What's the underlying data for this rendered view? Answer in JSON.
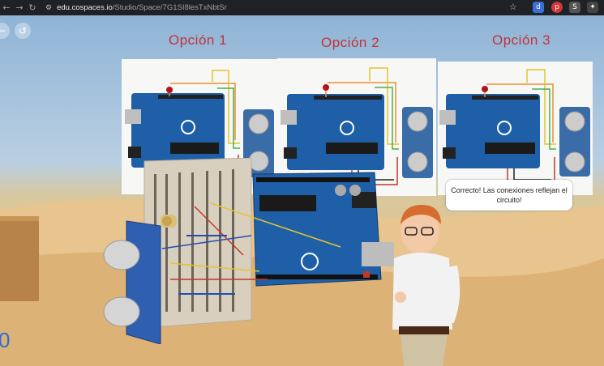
{
  "browser": {
    "back_icon": "arrow-left-icon",
    "forward_icon": "arrow-right-icon",
    "reload_icon": "reload-icon",
    "url_domain": "edu.cospaces.io",
    "url_path": "/Studio/Space/7G1SI8lesTxNbtSr"
  },
  "scene": {
    "options": [
      {
        "label": "Opción 1"
      },
      {
        "label": "Opción 2"
      },
      {
        "label": "Opción 3"
      }
    ],
    "speech_bubble": "Correcto!  Las conexiones reflejan el circuito!",
    "partial_number": "0"
  },
  "colors": {
    "option_title": "#c4323a",
    "arduino_blue": "#1f5fa8"
  }
}
